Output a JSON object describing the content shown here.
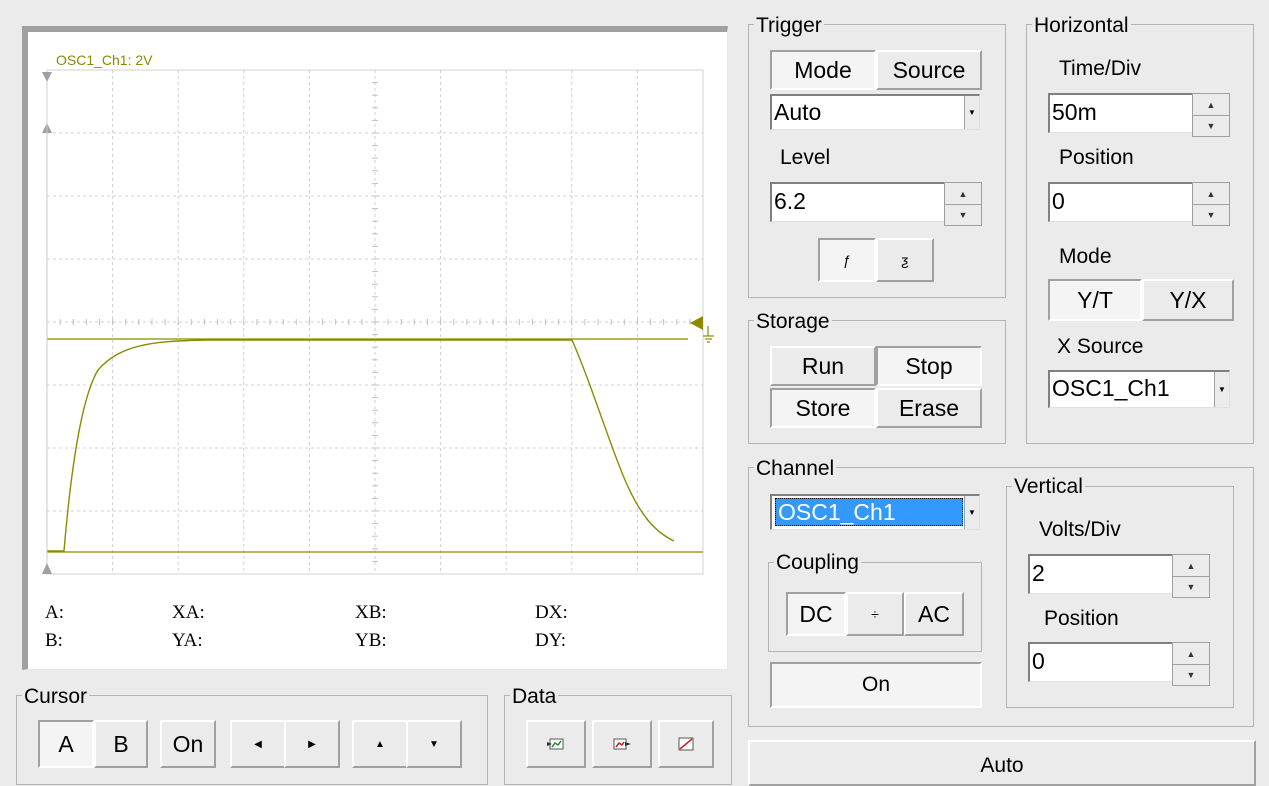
{
  "screen": {
    "channel_label": "OSC1_Ch1: 2V",
    "trace_color": "#8b8b00",
    "measurements": {
      "a": "A:",
      "b": "B:",
      "xa": "XA:",
      "ya": "YA:",
      "xb": "XB:",
      "yb": "YB:",
      "dx": "DX:",
      "dy": "DY:"
    }
  },
  "trigger": {
    "title": "Trigger",
    "mode_label": "Mode",
    "source_label": "Source",
    "mode_value": "Auto",
    "level_label": "Level",
    "level_value": "6.2",
    "rising_edge_icon": "rising-edge",
    "falling_edge_icon": "falling-edge"
  },
  "horizontal": {
    "title": "Horizontal",
    "time_div_label": "Time/Div",
    "time_div_value": "50m",
    "position_label": "Position",
    "position_value": "0",
    "mode_label": "Mode",
    "yt_label": "Y/T",
    "yx_label": "Y/X",
    "x_source_label": "X Source",
    "x_source_value": "OSC1_Ch1"
  },
  "storage": {
    "title": "Storage",
    "run_label": "Run",
    "stop_label": "Stop",
    "store_label": "Store",
    "erase_label": "Erase"
  },
  "channel": {
    "title": "Channel",
    "selected": "OSC1_Ch1",
    "selected_bg": "#3399ff",
    "coupling_title": "Coupling",
    "dc_label": "DC",
    "ground_label": "÷",
    "ac_label": "AC",
    "on_label": "On"
  },
  "vertical": {
    "title": "Vertical",
    "volts_div_label": "Volts/Div",
    "volts_div_value": "2",
    "position_label": "Position",
    "position_value": "0"
  },
  "cursor": {
    "title": "Cursor",
    "a_label": "A",
    "b_label": "B",
    "on_label": "On"
  },
  "data_panel": {
    "title": "Data"
  },
  "auto_label": "Auto"
}
